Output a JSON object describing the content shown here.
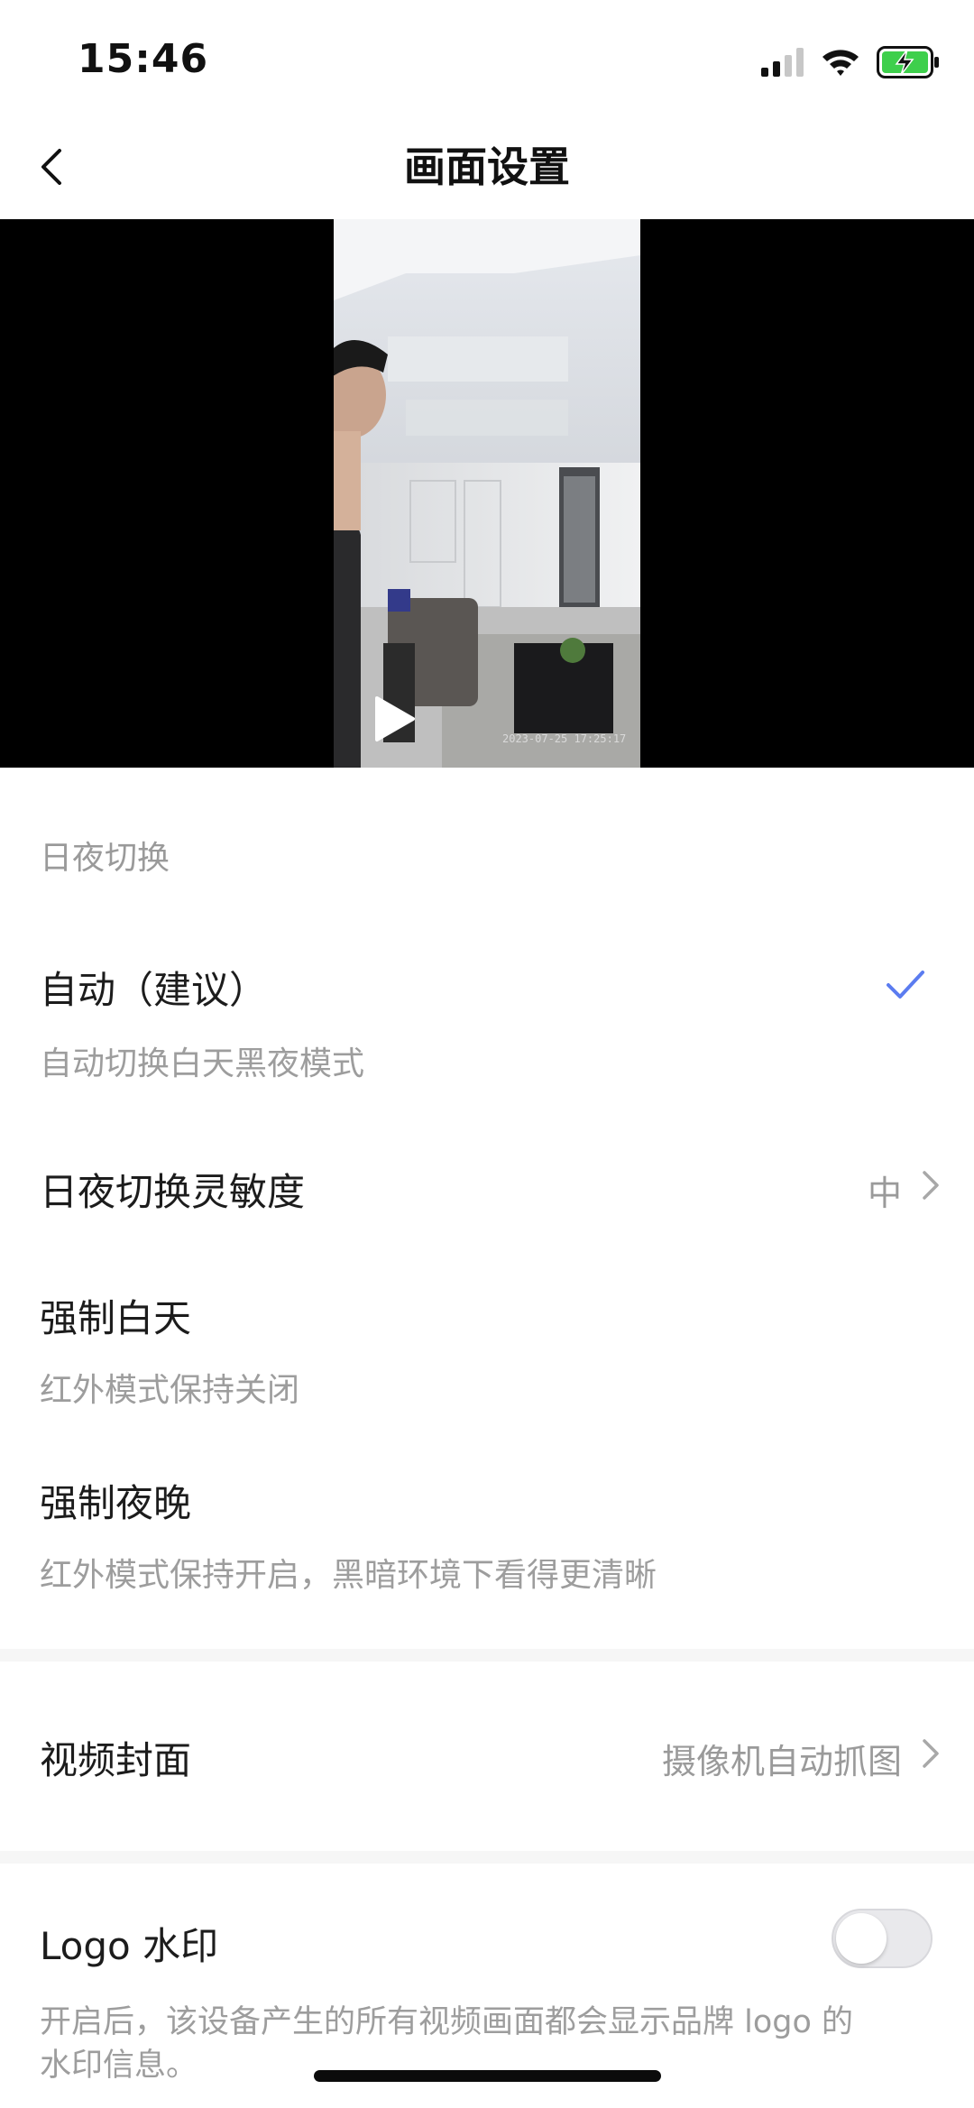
{
  "status_bar": {
    "time": "15:46"
  },
  "nav": {
    "title": "画面设置"
  },
  "video": {
    "timestamp": "2023-07-25 17:25:17"
  },
  "day_night": {
    "section_label": "日夜切换",
    "auto_title": "自动（建议）",
    "auto_sub": "自动切换白天黑夜模式",
    "sensitivity_title": "日夜切换灵敏度",
    "sensitivity_value": "中",
    "force_day_title": "强制白天",
    "force_day_sub": "红外模式保持关闭",
    "force_night_title": "强制夜晚",
    "force_night_sub": "红外模式保持开启，黑暗环境下看得更清晰"
  },
  "cover": {
    "title": "视频封面",
    "value": "摄像机自动抓图"
  },
  "logo": {
    "title": "Logo 水印",
    "desc_line1": "开启后，该设备产生的所有视频画面都会显示品牌 logo 的",
    "desc_line2": "水印信息。",
    "enabled": false
  },
  "colors": {
    "accent": "#5b7cf0",
    "battery": "#3ecf4c"
  }
}
